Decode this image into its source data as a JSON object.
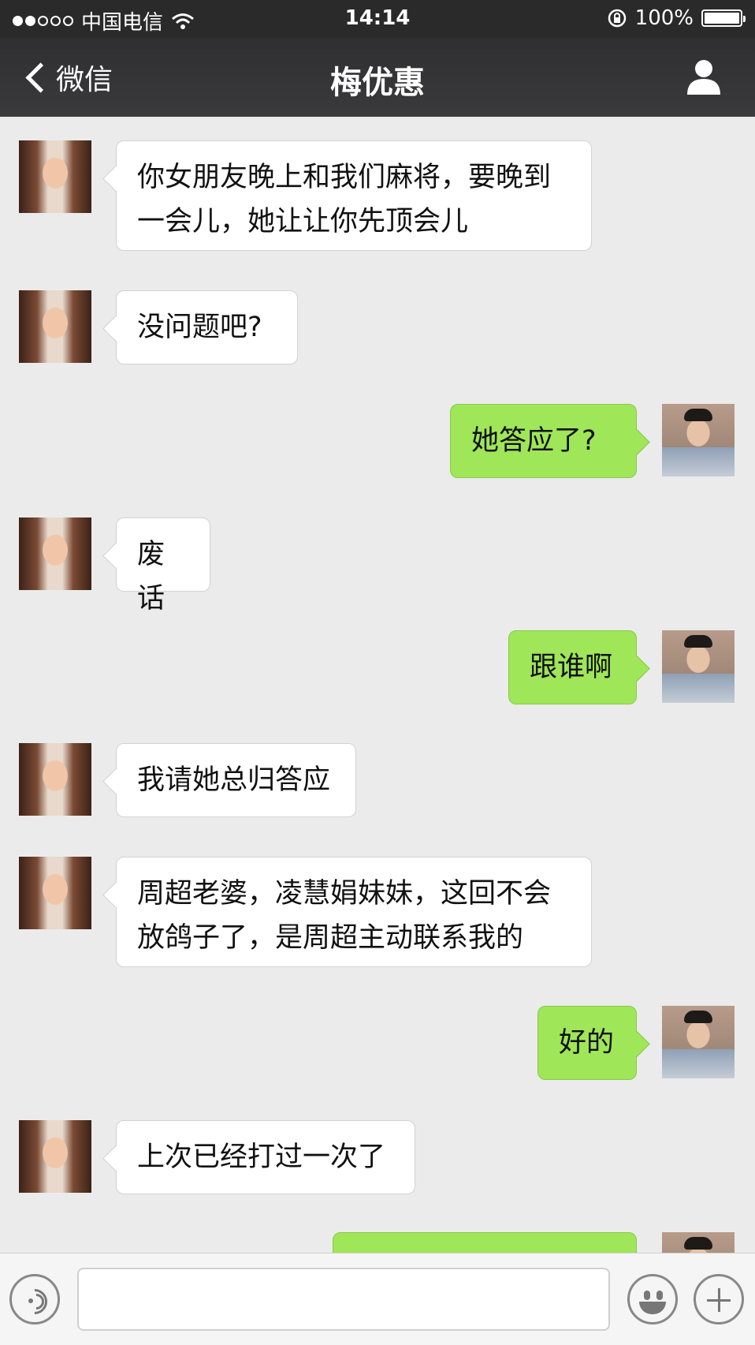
{
  "status_bar": {
    "carrier": "中国电信",
    "time": "14:14",
    "battery": "100%",
    "signal_bars_filled": 2,
    "signal_bars_total": 5
  },
  "nav": {
    "back_label": "微信",
    "title": "梅优惠"
  },
  "messages": [
    {
      "sender": "contact",
      "text": "你女朋友晚上和我们麻将，要晚到\n一会儿，她让让你先顶会儿"
    },
    {
      "sender": "contact",
      "text": "没问题吧?"
    },
    {
      "sender": "me",
      "text": "她答应了?"
    },
    {
      "sender": "contact",
      "text": "废话"
    },
    {
      "sender": "me",
      "text": "跟谁啊"
    },
    {
      "sender": "contact",
      "text": "我请她总归答应"
    },
    {
      "sender": "contact",
      "text": "周超老婆，凌慧娟妹妹，这回不会\n放鸽子了，是周超主动联系我的"
    },
    {
      "sender": "me",
      "text": "好的"
    },
    {
      "sender": "contact",
      "text": "上次已经打过一次了"
    },
    {
      "sender": "me",
      "text": ""
    }
  ],
  "input_bar": {
    "text_value": "",
    "icons": [
      "voice-icon",
      "emoji-icon",
      "plus-icon"
    ]
  },
  "colors": {
    "outgoing_bubble": "#9fe658",
    "incoming_bubble": "#ffffff",
    "nav_background": "#3a3a3c",
    "chat_background": "#ebebeb"
  }
}
